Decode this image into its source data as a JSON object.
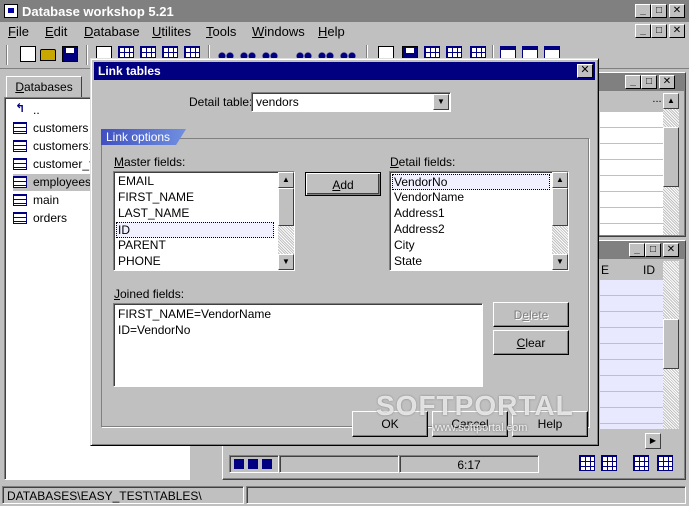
{
  "app": {
    "title": "Database workshop 5.21",
    "window_buttons": [
      "_",
      "□",
      "✕"
    ]
  },
  "menubar": [
    {
      "label": "File",
      "accel": "F",
      "rest": "ile"
    },
    {
      "label": "Edit",
      "accel": "E",
      "rest": "dit"
    },
    {
      "label": "Database",
      "accel": "D",
      "rest": "atabase"
    },
    {
      "label": "Utilites",
      "accel": "U",
      "rest": "tilites"
    },
    {
      "label": "Tools",
      "accel": "T",
      "rest": "ools"
    },
    {
      "label": "Windows",
      "accel": "W",
      "rest": "indows"
    },
    {
      "label": "Help",
      "accel": "H",
      "rest": "elp"
    }
  ],
  "toolbar_icons": [
    "new-document-icon",
    "open-folder-icon",
    "save-disk-icon",
    "copy-icon",
    "paste-icon",
    "grid-icon",
    "binoculars-icon",
    "binoculars-next-icon",
    "table-icon",
    "table-structure-icon",
    "document-icon",
    "query-icon",
    "window-tile-icon"
  ],
  "left_panel": {
    "tab": {
      "label": "Databases",
      "accel": "D",
      "rest": "atabases"
    },
    "items": [
      {
        "label": "..",
        "type": "up"
      },
      {
        "label": "customers",
        "type": "table"
      },
      {
        "label": "customers1",
        "type": "table"
      },
      {
        "label": "customer_filter",
        "type": "table"
      },
      {
        "label": "employees",
        "type": "table",
        "selected": true
      },
      {
        "label": "main",
        "type": "table"
      },
      {
        "label": "orders",
        "type": "table"
      }
    ]
  },
  "background_windows": {
    "lower_grid": {
      "col_headers": [
        "E",
        "ID"
      ],
      "time": "6:17"
    }
  },
  "dialog": {
    "title": "Link tables",
    "detail_table_label": "Detail table:",
    "detail_table_value": "vendors",
    "group_title": "Link options",
    "master_fields_label": {
      "accel": "M",
      "rest": "aster fields:"
    },
    "master_fields": [
      "EMAIL",
      "FIRST_NAME",
      "LAST_NAME",
      "ID",
      "PARENT",
      "PHONE"
    ],
    "master_focused_index": 3,
    "detail_fields_label": {
      "accel": "D",
      "rest": "etail fields:"
    },
    "detail_fields": [
      "VendorNo",
      "VendorName",
      "Address1",
      "Address2",
      "City",
      "State"
    ],
    "detail_focused_index": 0,
    "add_button": {
      "accel": "A",
      "rest": "dd"
    },
    "joined_fields_label": {
      "accel": "J",
      "rest": "oined fields:"
    },
    "joined_fields": [
      "FIRST_NAME=VendorName",
      "ID=VendorNo"
    ],
    "delete_button": {
      "accel": "e",
      "pre": "D",
      "rest": "lete"
    },
    "clear_button": {
      "accel": "C",
      "rest": "lear"
    },
    "ok_button": "OK",
    "cancel_button": "Cancel",
    "help_button": "Help"
  },
  "status": {
    "path": "DATABASES\\EASY_TEST\\TABLES\\"
  },
  "watermark": {
    "brand": "SOFTPORTAL",
    "url": "www.softportal.com"
  }
}
